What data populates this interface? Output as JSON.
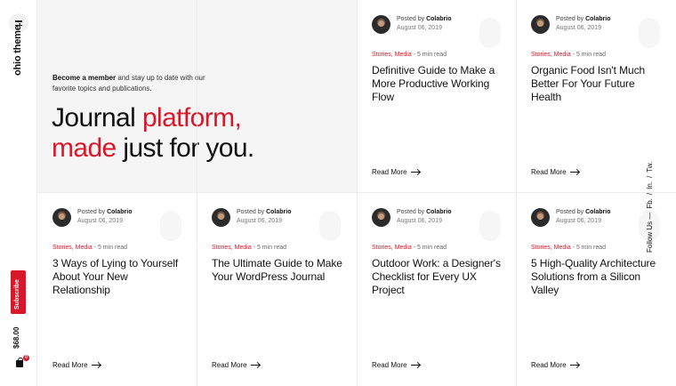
{
  "sidebar": {
    "logo_text": "ohio theme.",
    "subscribe_label": "Subscribe",
    "price": "$68.00",
    "cart_count": "0"
  },
  "social": {
    "follow_label": "Follow Us —",
    "links": [
      "Fb.",
      "In.",
      "Tw."
    ],
    "separator": "/"
  },
  "hero": {
    "intro_bold": "Become a member",
    "intro_rest": " and stay up to date with our favorite topics and publications.",
    "title_part1": "Journal ",
    "title_part2": "platform,",
    "title_part3": "made",
    "title_part4": " just for you."
  },
  "posts": [
    {
      "posted_by": "Posted by",
      "author": "Colabrio",
      "date": "August 06, 2019",
      "categories": "Stories, Media",
      "read_time": " - 5 min read",
      "title": "Definitive Guide to Make a More Productive Working Flow",
      "read_more": "Read More"
    },
    {
      "posted_by": "Posted by",
      "author": "Colabrio",
      "date": "August 06, 2019",
      "categories": "Stories, Media",
      "read_time": " - 5 min read",
      "title": "Organic Food Isn't Much Better For Your Future Health",
      "read_more": "Read More"
    },
    {
      "posted_by": "Posted by",
      "author": "Colabrio",
      "date": "August 06, 2019",
      "categories": "Stories, Media",
      "read_time": " - 5 min read",
      "title": "3 Ways of Lying to Yourself About Your New Relationship",
      "read_more": "Read More"
    },
    {
      "posted_by": "Posted by",
      "author": "Colabrio",
      "date": "August 06, 2019",
      "categories": "Stories, Media",
      "read_time": " - 5 min read",
      "title": "The Ultimate Guide to Make Your WordPress Journal",
      "read_more": "Read More"
    },
    {
      "posted_by": "Posted by",
      "author": "Colabrio",
      "date": "August 06, 2019",
      "categories": "Stories, Media",
      "read_time": " - 5 min read",
      "title": "Outdoor Work: a Designer's Checklist for Every UX Project",
      "read_more": "Read More"
    },
    {
      "posted_by": "Posted by",
      "author": "Colabrio",
      "date": "August 06, 2019",
      "categories": "Stories, Media",
      "read_time": " - 5 min read",
      "title": "5 High-Quality Architecture Solutions from a Silicon Valley",
      "read_more": "Read More"
    }
  ],
  "colors": {
    "accent": "#d9172a",
    "hero_bg": "#f5f5f5",
    "divider": "#ececec"
  }
}
